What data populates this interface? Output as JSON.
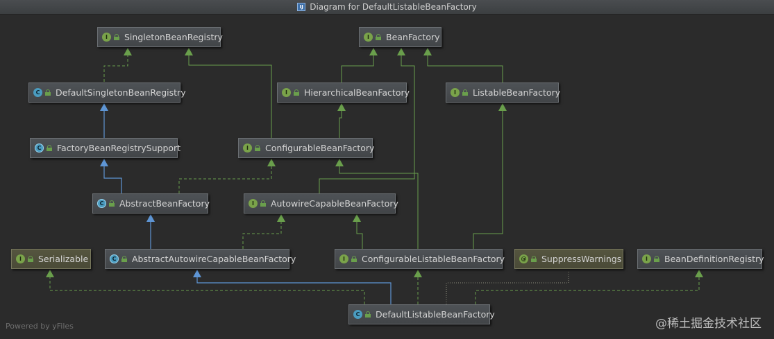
{
  "window": {
    "title": "Diagram for DefaultListableBeanFactory",
    "icon": "diagram-icon"
  },
  "nodes": {
    "singleton_registry": {
      "name": "SingletonBeanRegistry",
      "kind": "I"
    },
    "bean_factory": {
      "name": "BeanFactory",
      "kind": "I"
    },
    "default_singleton_registry": {
      "name": "DefaultSingletonBeanRegistry",
      "kind": "C"
    },
    "hierarchical_bean_factory": {
      "name": "HierarchicalBeanFactory",
      "kind": "I"
    },
    "listable_bean_factory": {
      "name": "ListableBeanFactory",
      "kind": "I"
    },
    "factory_bean_registry_support": {
      "name": "FactoryBeanRegistrySupport",
      "kind": "C"
    },
    "configurable_bean_factory": {
      "name": "ConfigurableBeanFactory",
      "kind": "I"
    },
    "abstract_bean_factory": {
      "name": "AbstractBeanFactory",
      "kind": "C"
    },
    "autowire_capable_bean_factory": {
      "name": "AutowireCapableBeanFactory",
      "kind": "I"
    },
    "serializable": {
      "name": "Serializable",
      "kind": "I"
    },
    "abstract_autowire_capable_bean_factory": {
      "name": "AbstractAutowireCapableBeanFactory",
      "kind": "C"
    },
    "configurable_listable_bean_factory": {
      "name": "ConfigurableListableBeanFactory",
      "kind": "I"
    },
    "suppress_warnings": {
      "name": "SuppressWarnings",
      "kind": "@"
    },
    "bean_definition_registry": {
      "name": "BeanDefinitionRegistry",
      "kind": "I"
    },
    "default_listable_bean_factory": {
      "name": "DefaultListableBeanFactory",
      "kind": "C"
    }
  },
  "colors": {
    "background": "#2b2b2b",
    "extends_edge": "#5e95d4",
    "implements_edge": "#6a9f4c",
    "annotation_edge": "#8a8a78",
    "interface_badge": "#7aa34a",
    "class_badge": "#4a9cc0"
  },
  "footer": {
    "powered_by": "Powered by yFiles",
    "watermark": "@稀土掘金技术社区"
  }
}
